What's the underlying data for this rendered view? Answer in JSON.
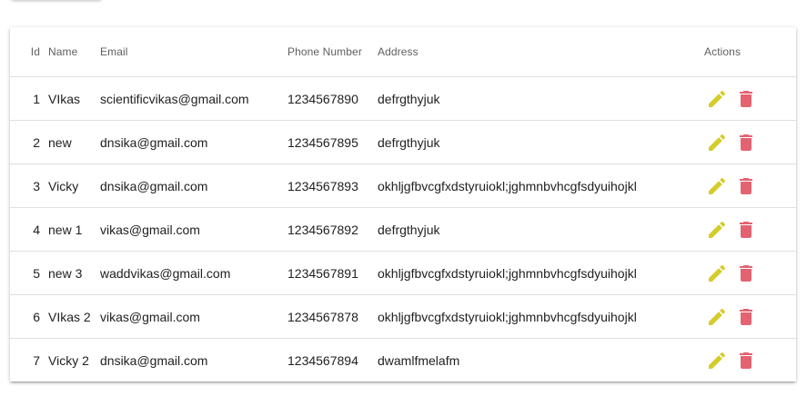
{
  "table": {
    "headers": {
      "id": "Id",
      "name": "Name",
      "email": "Email",
      "phone": "Phone Number",
      "address": "Address",
      "actions": "Actions"
    },
    "rows": [
      {
        "id": "1",
        "name": "VIkas",
        "email": "scientificvikas@gmail.com",
        "phone": "1234567890",
        "address": "defrgthyjuk"
      },
      {
        "id": "2",
        "name": "new",
        "email": "dnsika@gmail.com",
        "phone": "1234567895",
        "address": "defrgthyjuk"
      },
      {
        "id": "3",
        "name": "Vicky",
        "email": "dnsika@gmail.com",
        "phone": "1234567893",
        "address": "okhljgfbvcgfxdstyruiokl;jghmnbvhcgfsdyuihojkl"
      },
      {
        "id": "4",
        "name": "new 1",
        "email": "vikas@gmail.com",
        "phone": "1234567892",
        "address": "defrgthyjuk"
      },
      {
        "id": "5",
        "name": "new 3",
        "email": "waddvikas@gmail.com",
        "phone": "1234567891",
        "address": "okhljgfbvcgfxdstyruiokl;jghmnbvhcgfsdyuihojkl"
      },
      {
        "id": "6",
        "name": "VIkas 2",
        "email": "vikas@gmail.com",
        "phone": "1234567878",
        "address": "okhljgfbvcgfxdstyruiokl;jghmnbvhcgfsdyuihojkl"
      },
      {
        "id": "7",
        "name": "Vicky 2",
        "email": "dnsika@gmail.com",
        "phone": "1234567894",
        "address": "dwamlfmelafm"
      }
    ]
  },
  "icons": {
    "edit": "pencil-icon",
    "delete": "trash-icon"
  },
  "colors": {
    "edit_icon": "#d4cc2a",
    "delete_icon": "#e36371",
    "text": "#212121",
    "header_text": "#5f5f5f",
    "divider": "#e0e0e0"
  }
}
